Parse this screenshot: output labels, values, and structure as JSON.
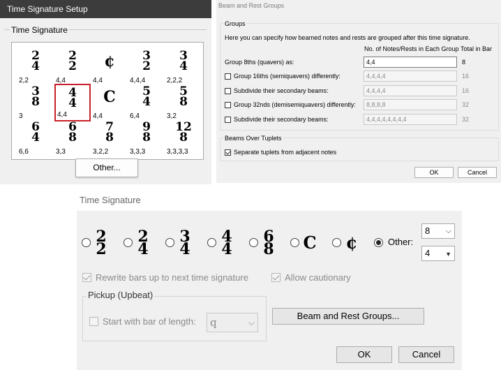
{
  "setup_dialog": {
    "title": "Time Signature Setup",
    "group_label": "Time Signature",
    "signatures": [
      {
        "top": "2",
        "bottom": "4",
        "groups": "2,2"
      },
      {
        "top": "2",
        "bottom": "2",
        "groups": "4,4"
      },
      {
        "symbol": "¢",
        "groups": "4,4"
      },
      {
        "top": "3",
        "bottom": "2",
        "groups": "4,4,4"
      },
      {
        "top": "3",
        "bottom": "4",
        "groups": "2,2,2"
      },
      {
        "top": "3",
        "bottom": "8",
        "groups": "3"
      },
      {
        "top": "4",
        "bottom": "4",
        "groups": "4,4",
        "selected": true
      },
      {
        "symbol": "C",
        "groups": "4,4"
      },
      {
        "top": "5",
        "bottom": "4",
        "groups": "6,4"
      },
      {
        "top": "5",
        "bottom": "8",
        "groups": "3,2"
      },
      {
        "top": "6",
        "bottom": "4",
        "groups": "6,6"
      },
      {
        "top": "6",
        "bottom": "8",
        "groups": "3,3"
      },
      {
        "top": "7",
        "bottom": "8",
        "groups": "3,2,2"
      },
      {
        "top": "9",
        "bottom": "8",
        "groups": "3,3,3"
      },
      {
        "top": "12",
        "bottom": "8",
        "groups": "3,3,3,3"
      }
    ],
    "other_button": "Other..."
  },
  "beam_dialog": {
    "title": "Beam and Rest Groups",
    "groups_label": "Groups",
    "description": "Here you can specify how beamed notes and rests are grouped after this time signature.",
    "col_notes": "No. of Notes/Rests in Each Group",
    "col_total": "Total in Bar",
    "rows": [
      {
        "label": "Group 8ths (quavers) as:",
        "value": "4,4",
        "total": "8",
        "checkbox": false,
        "active": true
      },
      {
        "label": "Group 16ths (semiquavers) differently:",
        "value": "4,4,4,4",
        "total": "16",
        "checkbox": true,
        "active": false
      },
      {
        "label": "Subdivide their secondary beams:",
        "value": "4,4,4,4",
        "total": "16",
        "checkbox": true,
        "active": false
      },
      {
        "label": "Group 32nds (demisemiquavers) differently:",
        "value": "8,8,8,8",
        "total": "32",
        "checkbox": true,
        "active": false
      },
      {
        "label": "Subdivide their secondary beams:",
        "value": "4,4,4,4,4,4,4,4",
        "total": "32",
        "checkbox": true,
        "active": false
      }
    ],
    "tuplets_label": "Beams Over Tuplets",
    "tuplets_option": "Separate tuplets from adjacent notes",
    "ok": "OK",
    "cancel": "Cancel"
  },
  "ts_dialog": {
    "title": "Time Signature",
    "options": [
      {
        "top": "2",
        "bottom": "2"
      },
      {
        "top": "2",
        "bottom": "4"
      },
      {
        "top": "3",
        "bottom": "4"
      },
      {
        "top": "4",
        "bottom": "4"
      },
      {
        "top": "6",
        "bottom": "8"
      },
      {
        "symbol": "C"
      },
      {
        "symbol": "¢"
      }
    ],
    "other_label": "Other:",
    "other_top": "8",
    "other_bottom": "4",
    "rewrite_bars": "Rewrite bars up to next time signature",
    "allow_cautionary": "Allow cautionary",
    "pickup_label": "Pickup (Upbeat)",
    "pickup_option": "Start with bar of length:",
    "pickup_value": "q",
    "beam_button": "Beam and Rest Groups...",
    "ok": "OK",
    "cancel": "Cancel"
  }
}
